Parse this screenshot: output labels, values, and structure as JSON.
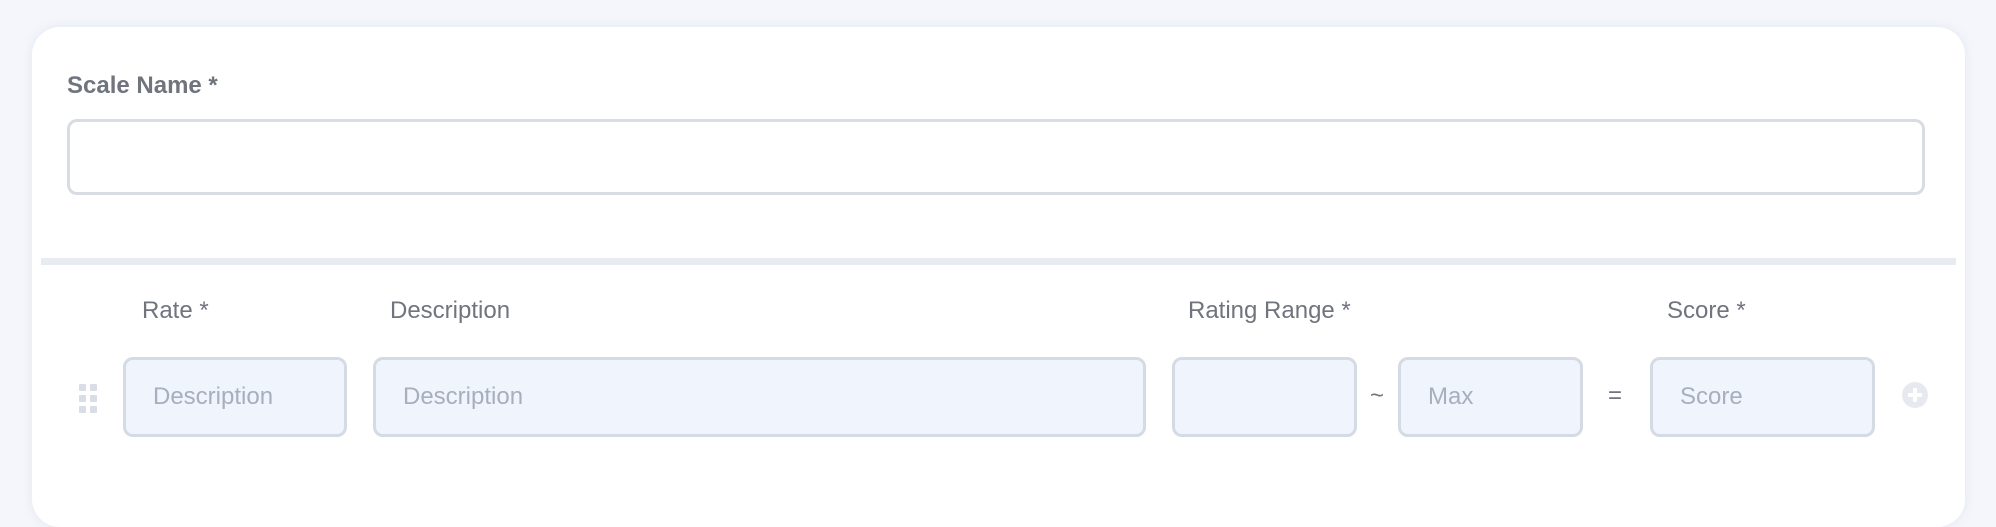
{
  "form": {
    "scale_name_label": "Scale Name *",
    "scale_name_value": ""
  },
  "columns": {
    "rate": "Rate *",
    "description": "Description",
    "rating_range": "Rating Range *",
    "score": "Score *"
  },
  "row": {
    "rate_placeholder": "Description",
    "description_placeholder": "Description",
    "min_placeholder": "",
    "range_separator": "~",
    "max_placeholder": "Max",
    "equals": "=",
    "score_placeholder": "Score"
  },
  "icons": {
    "drag": "drag-handle-icon",
    "add": "plus-circle-icon"
  }
}
